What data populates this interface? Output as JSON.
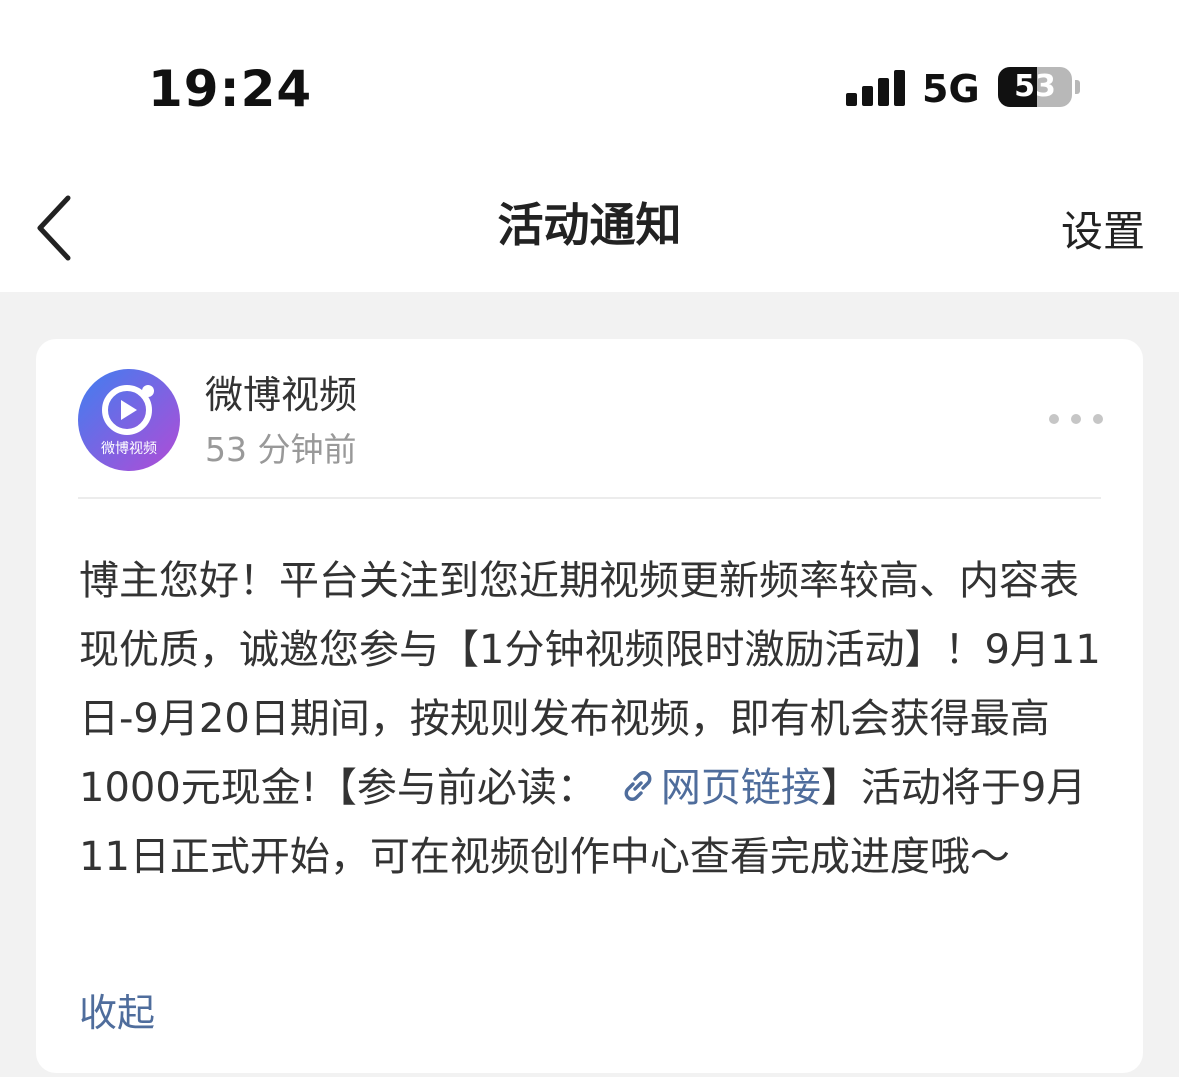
{
  "status_bar": {
    "time": "19:24",
    "network": "5G",
    "battery_level": "53",
    "battery_percent": 53,
    "signal_icon": "signal-bars-icon",
    "battery_icon": "battery-icon"
  },
  "nav": {
    "back_icon": "chevron-left-icon",
    "title": "活动通知",
    "settings_label": "设置"
  },
  "notification": {
    "sender_name": "微博视频",
    "avatar_text": "微博视频",
    "sent_time": "53 分钟前",
    "more_icon": "more-dots-icon",
    "message_parts": {
      "p1": "博主您好！平台关注到您近期视频更新频率较高、内容表现优质，诚邀您参与【1分钟视频限时激励活动】！9月11日-9月20日期间，按规则发布视频，即有机会获得最高1000元现金!【参与前必读：",
      "link_text": "网页链接",
      "p2": "】活动将于9月11日正式开始，可在视频创作中心查看完成进度哦～"
    },
    "collapse_label": "收起"
  },
  "colors": {
    "link": "#4f6d9c",
    "page_background": "#f2f2f2",
    "avatar_gradient_start": "#3f7ff0",
    "avatar_gradient_end": "#b24bd6"
  }
}
